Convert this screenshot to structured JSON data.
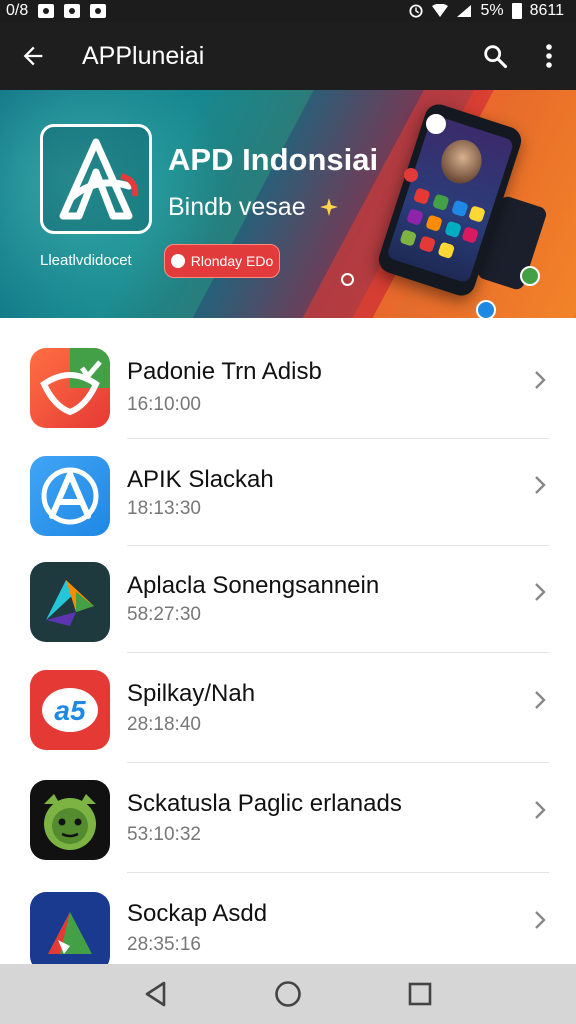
{
  "status_bar": {
    "left_text": "0/8",
    "battery_text": "5%",
    "time": "8611",
    "icons": [
      "image-icon",
      "circle-icon",
      "square-icon",
      "alarm-icon",
      "wifi-icon",
      "signal-icon",
      "battery-icon"
    ]
  },
  "app_bar": {
    "title": "APPluneiai",
    "back_icon": "arrow-back-icon",
    "search_icon": "search-icon",
    "more_icon": "more-vert-icon"
  },
  "banner": {
    "title": "APD Indonsiai",
    "subtitle": "Bindb vesae",
    "caption": "Lleatlvdidocet",
    "cta_label": "Rlonday EDo",
    "colors": {
      "teal": "#17888f",
      "red": "#d84a2f",
      "orange": "#ef7a2a",
      "cta": "#e23b3b"
    }
  },
  "apps": [
    {
      "name": "Padonie Trn Adisb",
      "time": "16:10:00",
      "icon": "orange-green-app-icon"
    },
    {
      "name": "APIK Slackah",
      "time": "18:13:30",
      "icon": "blue-a-app-icon"
    },
    {
      "name": "Aplacla Sonengsannein",
      "time": "58:27:30",
      "icon": "dark-arrow-app-icon"
    },
    {
      "name": "Spilkay/Nah",
      "time": "28:18:40",
      "icon": "red-a5-app-icon"
    },
    {
      "name": "Sckatusla Paglic erlanads",
      "time": "53:10:32",
      "icon": "green-face-app-icon"
    },
    {
      "name": "Sockap Asdd",
      "time": "28:35:16",
      "icon": "blue-triangle-app-icon"
    }
  ],
  "nav_bar": {
    "back": "nav-back-icon",
    "home": "nav-home-icon",
    "recents": "nav-recents-icon"
  }
}
